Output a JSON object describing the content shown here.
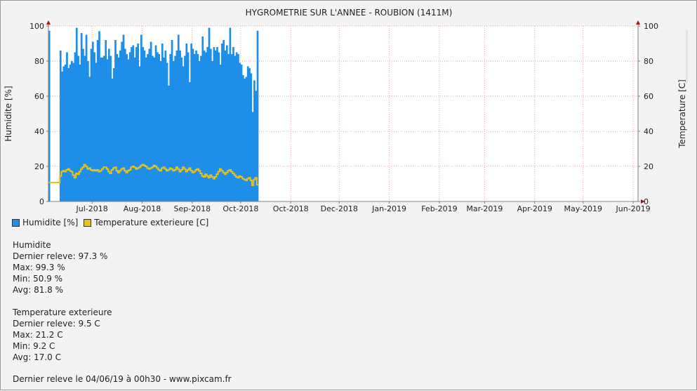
{
  "chart_data": {
    "type": "bar",
    "title": "HYGROMETRIE SUR L'ANNEE - ROUBION (1411M)",
    "ylabel": "Humidite [%]",
    "y2label": "Temperature [C]",
    "ylim": [
      0,
      100
    ],
    "y2lim": [
      0,
      100
    ],
    "yticks": [
      "0",
      "20",
      "40",
      "60",
      "80",
      "100"
    ],
    "y2ticks": [
      "0",
      "20",
      "40",
      "60",
      "80",
      "100"
    ],
    "xlim": [
      "2018-06-04",
      "2019-06-04"
    ],
    "xticks": [
      {
        "date": "2018-07-01",
        "label": "Jul-2018"
      },
      {
        "date": "2018-08-01",
        "label": "Aug-2018"
      },
      {
        "date": "2018-09-01",
        "label": "Sep-2018"
      },
      {
        "date": "2018-10-01",
        "label": "Oct-2018"
      },
      {
        "date": "2018-11-01",
        "label": "Oct-2018"
      },
      {
        "date": "2018-12-01",
        "label": "Dec-2018"
      },
      {
        "date": "2019-01-01",
        "label": "Jan-2019"
      },
      {
        "date": "2019-02-01",
        "label": "Feb-2019"
      },
      {
        "date": "2019-03-01",
        "label": "Mar-2019"
      },
      {
        "date": "2019-04-01",
        "label": "Apr-2019"
      },
      {
        "date": "2019-05-01",
        "label": "May-2019"
      },
      {
        "date": "2019-06-01",
        "label": "Jun-2019"
      }
    ],
    "grid": true,
    "legend_position": "bottom-left",
    "series": [
      {
        "name": "Humidite [%]",
        "type": "bar",
        "color": "#1e8ee8",
        "points": [
          [
            "2018-06-04",
            97.3
          ],
          [
            "2018-06-11",
            86
          ],
          [
            "2018-06-12",
            74
          ],
          [
            "2018-06-13",
            77
          ],
          [
            "2018-06-14",
            78
          ],
          [
            "2018-06-15",
            85
          ],
          [
            "2018-06-16",
            76
          ],
          [
            "2018-06-17",
            78
          ],
          [
            "2018-06-18",
            80
          ],
          [
            "2018-06-19",
            79
          ],
          [
            "2018-06-20",
            85
          ],
          [
            "2018-06-21",
            99
          ],
          [
            "2018-06-22",
            83
          ],
          [
            "2018-06-23",
            78
          ],
          [
            "2018-06-24",
            96
          ],
          [
            "2018-06-25",
            87
          ],
          [
            "2018-06-26",
            83
          ],
          [
            "2018-06-27",
            95
          ],
          [
            "2018-06-28",
            80
          ],
          [
            "2018-06-29",
            71
          ],
          [
            "2018-06-30",
            87
          ],
          [
            "2018-07-01",
            91
          ],
          [
            "2018-07-02",
            85
          ],
          [
            "2018-07-03",
            79
          ],
          [
            "2018-07-04",
            92
          ],
          [
            "2018-07-05",
            97
          ],
          [
            "2018-07-06",
            82
          ],
          [
            "2018-07-07",
            82
          ],
          [
            "2018-07-08",
            83
          ],
          [
            "2018-07-09",
            92
          ],
          [
            "2018-07-10",
            81
          ],
          [
            "2018-07-11",
            87
          ],
          [
            "2018-07-12",
            83
          ],
          [
            "2018-07-13",
            70
          ],
          [
            "2018-07-14",
            76
          ],
          [
            "2018-07-15",
            92
          ],
          [
            "2018-07-16",
            84
          ],
          [
            "2018-07-17",
            82
          ],
          [
            "2018-07-18",
            86
          ],
          [
            "2018-07-19",
            91
          ],
          [
            "2018-07-20",
            95
          ],
          [
            "2018-07-21",
            87
          ],
          [
            "2018-07-22",
            84
          ],
          [
            "2018-07-23",
            81
          ],
          [
            "2018-07-24",
            85
          ],
          [
            "2018-07-25",
            88
          ],
          [
            "2018-07-26",
            89
          ],
          [
            "2018-07-27",
            82
          ],
          [
            "2018-07-28",
            88
          ],
          [
            "2018-07-29",
            90
          ],
          [
            "2018-07-30",
            77
          ],
          [
            "2018-07-31",
            95
          ],
          [
            "2018-08-01",
            88
          ],
          [
            "2018-08-02",
            86
          ],
          [
            "2018-08-03",
            82
          ],
          [
            "2018-08-04",
            84
          ],
          [
            "2018-08-05",
            87
          ],
          [
            "2018-08-06",
            91
          ],
          [
            "2018-08-07",
            83
          ],
          [
            "2018-08-08",
            82
          ],
          [
            "2018-08-09",
            89
          ],
          [
            "2018-08-10",
            85
          ],
          [
            "2018-08-11",
            84
          ],
          [
            "2018-08-12",
            80
          ],
          [
            "2018-08-13",
            90
          ],
          [
            "2018-08-14",
            82
          ],
          [
            "2018-08-15",
            86
          ],
          [
            "2018-08-16",
            79
          ],
          [
            "2018-08-17",
            66
          ],
          [
            "2018-08-18",
            84
          ],
          [
            "2018-08-19",
            92
          ],
          [
            "2018-08-20",
            80
          ],
          [
            "2018-08-21",
            83
          ],
          [
            "2018-08-22",
            86
          ],
          [
            "2018-08-23",
            95
          ],
          [
            "2018-08-24",
            86
          ],
          [
            "2018-08-25",
            82
          ],
          [
            "2018-08-26",
            77
          ],
          [
            "2018-08-27",
            83
          ],
          [
            "2018-08-28",
            90
          ],
          [
            "2018-08-29",
            85
          ],
          [
            "2018-08-30",
            68
          ],
          [
            "2018-08-31",
            90
          ],
          [
            "2018-09-01",
            87
          ],
          [
            "2018-09-02",
            84
          ],
          [
            "2018-09-03",
            86
          ],
          [
            "2018-09-04",
            84
          ],
          [
            "2018-09-05",
            80
          ],
          [
            "2018-09-06",
            83
          ],
          [
            "2018-09-07",
            94
          ],
          [
            "2018-09-08",
            86
          ],
          [
            "2018-09-09",
            85
          ],
          [
            "2018-09-10",
            88
          ],
          [
            "2018-09-11",
            99
          ],
          [
            "2018-09-12",
            87
          ],
          [
            "2018-09-13",
            80
          ],
          [
            "2018-09-14",
            88
          ],
          [
            "2018-09-15",
            86
          ],
          [
            "2018-09-16",
            88
          ],
          [
            "2018-09-17",
            85
          ],
          [
            "2018-09-18",
            78
          ],
          [
            "2018-09-19",
            90
          ],
          [
            "2018-09-20",
            92
          ],
          [
            "2018-09-21",
            86
          ],
          [
            "2018-09-22",
            89
          ],
          [
            "2018-09-23",
            84
          ],
          [
            "2018-09-24",
            99
          ],
          [
            "2018-09-25",
            84
          ],
          [
            "2018-09-26",
            88
          ],
          [
            "2018-09-27",
            83
          ],
          [
            "2018-09-28",
            85
          ],
          [
            "2018-09-29",
            84
          ],
          [
            "2018-09-30",
            79
          ],
          [
            "2018-10-01",
            78
          ],
          [
            "2018-10-02",
            72
          ],
          [
            "2018-10-03",
            70
          ],
          [
            "2018-10-04",
            71
          ],
          [
            "2018-10-05",
            77
          ],
          [
            "2018-10-06",
            76
          ],
          [
            "2018-10-07",
            73
          ],
          [
            "2018-10-08",
            51
          ],
          [
            "2018-10-09",
            69
          ],
          [
            "2018-10-10",
            63
          ],
          [
            "2018-10-11",
            97.3
          ]
        ]
      },
      {
        "name": "Temperature exterieure [C]",
        "type": "step-line",
        "color": "#e8c21a",
        "points": [
          [
            "2018-06-04",
            10.8
          ],
          [
            "2018-06-11",
            14.5
          ],
          [
            "2018-06-12",
            17.0
          ],
          [
            "2018-06-13",
            17.5
          ],
          [
            "2018-06-14",
            17.0
          ],
          [
            "2018-06-15",
            18.0
          ],
          [
            "2018-06-16",
            18.5
          ],
          [
            "2018-06-17",
            17.5
          ],
          [
            "2018-06-18",
            17.0
          ],
          [
            "2018-06-19",
            15.0
          ],
          [
            "2018-06-20",
            13.5
          ],
          [
            "2018-06-21",
            16.0
          ],
          [
            "2018-06-22",
            15.5
          ],
          [
            "2018-06-23",
            17.0
          ],
          [
            "2018-06-24",
            18.5
          ],
          [
            "2018-06-25",
            19.5
          ],
          [
            "2018-06-26",
            21.0
          ],
          [
            "2018-06-27",
            20.0
          ],
          [
            "2018-06-28",
            18.5
          ],
          [
            "2018-06-29",
            19.0
          ],
          [
            "2018-06-30",
            18.0
          ],
          [
            "2018-07-01",
            17.5
          ],
          [
            "2018-07-02",
            18.0
          ],
          [
            "2018-07-03",
            17.5
          ],
          [
            "2018-07-04",
            18.0
          ],
          [
            "2018-07-05",
            17.0
          ],
          [
            "2018-07-06",
            17.5
          ],
          [
            "2018-07-07",
            18.5
          ],
          [
            "2018-07-08",
            19.5
          ],
          [
            "2018-07-09",
            19.5
          ],
          [
            "2018-07-10",
            18.5
          ],
          [
            "2018-07-11",
            17.0
          ],
          [
            "2018-07-12",
            16.0
          ],
          [
            "2018-07-13",
            18.0
          ],
          [
            "2018-07-14",
            19.0
          ],
          [
            "2018-07-15",
            19.5
          ],
          [
            "2018-07-16",
            17.5
          ],
          [
            "2018-07-17",
            16.5
          ],
          [
            "2018-07-18",
            17.5
          ],
          [
            "2018-07-19",
            18.5
          ],
          [
            "2018-07-20",
            19.0
          ],
          [
            "2018-07-21",
            17.5
          ],
          [
            "2018-07-22",
            16.5
          ],
          [
            "2018-07-23",
            17.5
          ],
          [
            "2018-07-24",
            18.0
          ],
          [
            "2018-07-25",
            19.5
          ],
          [
            "2018-07-26",
            20.0
          ],
          [
            "2018-07-27",
            19.5
          ],
          [
            "2018-07-28",
            18.5
          ],
          [
            "2018-07-29",
            19.0
          ],
          [
            "2018-07-30",
            19.5
          ],
          [
            "2018-07-31",
            20.5
          ],
          [
            "2018-08-01",
            21.0
          ],
          [
            "2018-08-02",
            20.5
          ],
          [
            "2018-08-03",
            20.0
          ],
          [
            "2018-08-04",
            19.0
          ],
          [
            "2018-08-05",
            18.5
          ],
          [
            "2018-08-06",
            19.0
          ],
          [
            "2018-08-07",
            19.5
          ],
          [
            "2018-08-08",
            20.5
          ],
          [
            "2018-08-09",
            20.0
          ],
          [
            "2018-08-10",
            19.0
          ],
          [
            "2018-08-11",
            18.0
          ],
          [
            "2018-08-12",
            17.5
          ],
          [
            "2018-08-13",
            19.0
          ],
          [
            "2018-08-14",
            19.5
          ],
          [
            "2018-08-15",
            18.5
          ],
          [
            "2018-08-16",
            17.5
          ],
          [
            "2018-08-17",
            18.0
          ],
          [
            "2018-08-18",
            19.0
          ],
          [
            "2018-08-19",
            18.5
          ],
          [
            "2018-08-20",
            17.5
          ],
          [
            "2018-08-21",
            18.0
          ],
          [
            "2018-08-22",
            19.5
          ],
          [
            "2018-08-23",
            18.5
          ],
          [
            "2018-08-24",
            17.0
          ],
          [
            "2018-08-25",
            18.0
          ],
          [
            "2018-08-26",
            19.5
          ],
          [
            "2018-08-27",
            18.5
          ],
          [
            "2018-08-28",
            17.0
          ],
          [
            "2018-08-29",
            18.0
          ],
          [
            "2018-08-30",
            19.0
          ],
          [
            "2018-08-31",
            17.5
          ],
          [
            "2018-09-01",
            16.5
          ],
          [
            "2018-09-02",
            17.0
          ],
          [
            "2018-09-03",
            18.0
          ],
          [
            "2018-09-04",
            18.5
          ],
          [
            "2018-09-05",
            17.5
          ],
          [
            "2018-09-06",
            16.0
          ],
          [
            "2018-09-07",
            14.5
          ],
          [
            "2018-09-08",
            14.0
          ],
          [
            "2018-09-09",
            15.5
          ],
          [
            "2018-09-10",
            14.5
          ],
          [
            "2018-09-11",
            13.5
          ],
          [
            "2018-09-12",
            15.0
          ],
          [
            "2018-09-13",
            14.0
          ],
          [
            "2018-09-14",
            13.0
          ],
          [
            "2018-09-15",
            14.0
          ],
          [
            "2018-09-16",
            15.5
          ],
          [
            "2018-09-17",
            17.0
          ],
          [
            "2018-09-18",
            18.5
          ],
          [
            "2018-09-19",
            17.5
          ],
          [
            "2018-09-20",
            16.5
          ],
          [
            "2018-09-21",
            15.5
          ],
          [
            "2018-09-22",
            16.5
          ],
          [
            "2018-09-23",
            17.5
          ],
          [
            "2018-09-24",
            18.0
          ],
          [
            "2018-09-25",
            17.0
          ],
          [
            "2018-09-26",
            16.0
          ],
          [
            "2018-09-27",
            15.0
          ],
          [
            "2018-09-28",
            14.0
          ],
          [
            "2018-09-29",
            13.5
          ],
          [
            "2018-09-30",
            14.5
          ],
          [
            "2018-10-01",
            14.0
          ],
          [
            "2018-10-02",
            13.0
          ],
          [
            "2018-10-03",
            12.5
          ],
          [
            "2018-10-04",
            12.0
          ],
          [
            "2018-10-05",
            13.0
          ],
          [
            "2018-10-06",
            13.5
          ],
          [
            "2018-10-07",
            12.0
          ],
          [
            "2018-10-08",
            9.2
          ],
          [
            "2018-10-09",
            12.5
          ],
          [
            "2018-10-10",
            13.5
          ],
          [
            "2018-10-11",
            9.5
          ]
        ]
      }
    ]
  },
  "legend": [
    {
      "label": "Humidite [%]",
      "color": "#1e8ee8"
    },
    {
      "label": "Temperature exterieure [C]",
      "color": "#e8c21a"
    }
  ],
  "stats": {
    "humidity": {
      "title": "Humidite",
      "last": "Dernier releve: 97.3 %",
      "max": "Max: 99.3 %",
      "min": "Min: 50.9 %",
      "avg": "Avg: 81.8 %"
    },
    "temperature": {
      "title": "Temperature exterieure",
      "last": "Dernier releve: 9.5 C",
      "max": "Max: 21.2 C",
      "min": "Min: 9.2 C",
      "avg": "Avg: 17.0 C"
    }
  },
  "footer": "Dernier releve le 04/06/19 à 00h30 - www.pixcam.fr",
  "colors": {
    "grid": "#e9a3a3",
    "axis": "#808080",
    "arrow": "#a01818"
  }
}
